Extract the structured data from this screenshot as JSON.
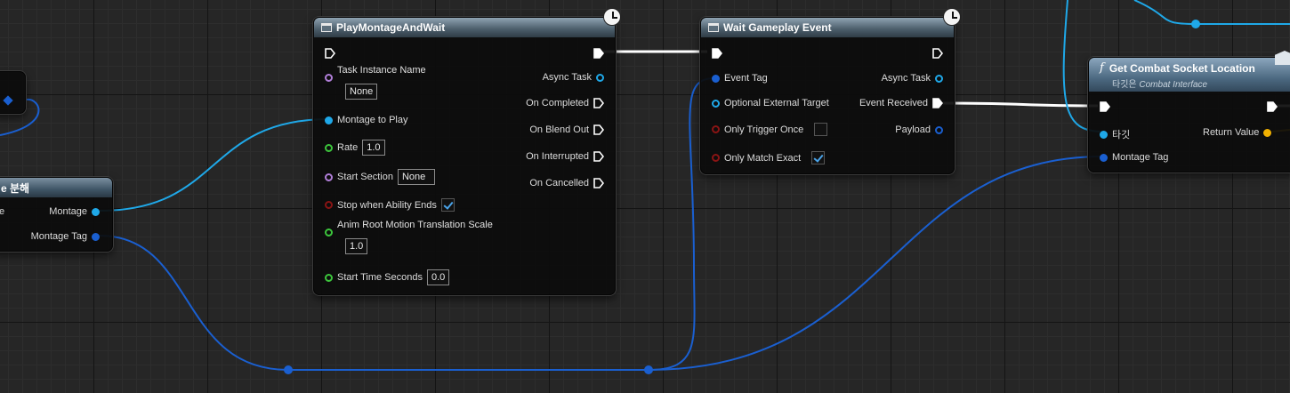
{
  "colors": {
    "exec": "#ffffff",
    "object_pin": "#1fa8e8",
    "struct_pin": "#1a5fd0",
    "float_pin": "#3cc53c",
    "bool_pin": "#8a1414",
    "name_pin": "#b07ed8",
    "vector_pin": "#f0b000",
    "node_header": "#4a5c69"
  },
  "break_node": {
    "title": "e 분해",
    "outputs": {
      "montage": "Montage",
      "montage_tag": "Montage Tag"
    },
    "left_fragment": "e"
  },
  "play_montage": {
    "title": "PlayMontageAndWait",
    "inputs": {
      "task_instance_name": "Task Instance Name",
      "task_instance_value": "None",
      "montage_to_play": "Montage to Play",
      "rate": "Rate",
      "rate_value": "1.0",
      "start_section": "Start Section",
      "start_section_value": "None",
      "stop_when_ability_ends": "Stop when Ability Ends",
      "anim_root_motion": "Anim Root Motion Translation Scale",
      "anim_root_motion_value": "1.0",
      "start_time_seconds": "Start Time Seconds",
      "start_time_value": "0.0"
    },
    "outputs": {
      "async_task": "Async Task",
      "on_completed": "On Completed",
      "on_blend_out": "On Blend Out",
      "on_interrupted": "On Interrupted",
      "on_cancelled": "On Cancelled"
    },
    "stop_when_ability_ends_checked": true
  },
  "wait_event": {
    "title": "Wait Gameplay Event",
    "inputs": {
      "event_tag": "Event Tag",
      "optional_external_target": "Optional External Target",
      "only_trigger_once": "Only Trigger Once",
      "only_match_exact": "Only Match Exact"
    },
    "outputs": {
      "async_task": "Async Task",
      "event_received": "Event Received",
      "payload": "Payload"
    },
    "only_trigger_once_checked": false,
    "only_match_exact_checked": true
  },
  "combat_socket": {
    "title": "Get Combat Socket Location",
    "subtitle_prefix": "타깃은",
    "subtitle_interface": "Combat Interface",
    "inputs": {
      "target": "타깃",
      "montage_tag": "Montage Tag"
    },
    "outputs": {
      "return_value": "Return Value"
    }
  }
}
